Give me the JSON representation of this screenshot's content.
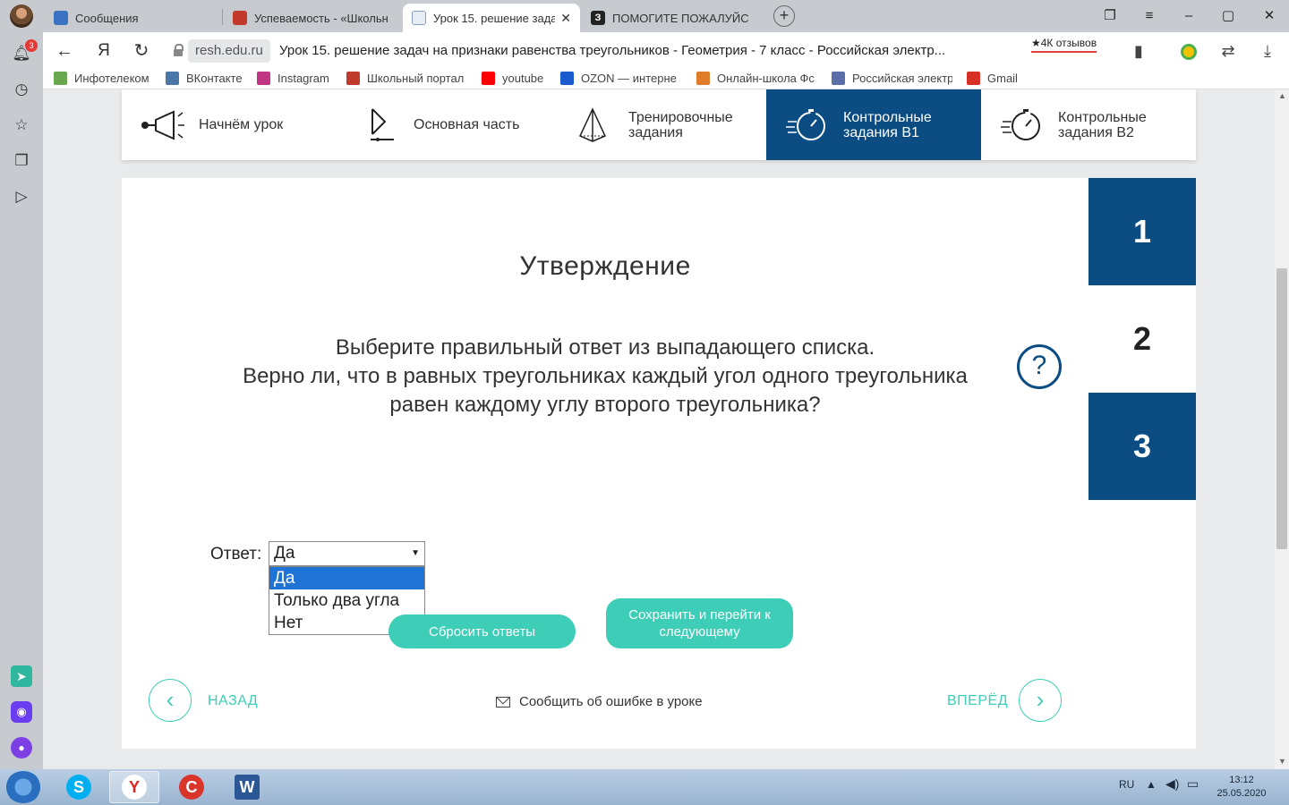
{
  "browser": {
    "tabs": [
      {
        "label": "Сообщения",
        "favicon_color": "#3b73c4"
      },
      {
        "label": "Успеваемость - «Школьн",
        "favicon_color": "#c0392b"
      },
      {
        "label": "Урок 15. решение зада",
        "favicon_color": "#4b6ea9",
        "active": true
      },
      {
        "label": "ПОМОГИТЕ ПОЖАЛУЙСТ",
        "favicon_color": "#222222"
      }
    ],
    "close_glyph": "✕",
    "new_tab_glyph": "+",
    "domain": "resh.edu.ru",
    "page_title": "Урок 15. решение задач на признаки равенства треугольников - Геометрия - 7 класс - Российская электр...",
    "reviews": "★4К отзывов",
    "bookmarks": [
      {
        "label": "Инфотелеком",
        "color": "#6aa84f"
      },
      {
        "label": "ВКонтакте",
        "color": "#4a76a8"
      },
      {
        "label": "Instagram",
        "color": "#c13584"
      },
      {
        "label": "Школьный портал",
        "color": "#c0392b"
      },
      {
        "label": "youtube",
        "color": "#ff0000"
      },
      {
        "label": "OZON — интерне",
        "color": "#1a5ccf"
      },
      {
        "label": "Онлайн-школа Фс",
        "color": "#e07b2a"
      },
      {
        "label": "Российская электр",
        "color": "#5b6ea8"
      },
      {
        "label": "Gmail",
        "color": "#d93025"
      }
    ],
    "notifications_badge": "3"
  },
  "lesson_nav": [
    {
      "label": "Начнём урок",
      "icon": "megaphone-icon"
    },
    {
      "label": "Основная часть",
      "icon": "play-icon"
    },
    {
      "label": "Тренировочные задания",
      "icon": "pyramid-icon"
    },
    {
      "label": "Контрольные задания В1",
      "icon": "timer-icon",
      "active": true
    },
    {
      "label": "Контрольные задания В2",
      "icon": "timer-icon"
    }
  ],
  "task": {
    "title": "Утверждение",
    "question_line1": "Выберите правильный ответ из выпадающего списка.",
    "question_line2": "Верно ли, что в равных треугольниках каждый угол одного треугольника",
    "question_line3": "равен каждому углу второго треугольника?",
    "help": "?",
    "answer_label": "Ответ:",
    "selected_value": "Да",
    "options": [
      "Да",
      "Только два угла",
      "Нет"
    ],
    "reset_label": "Сбросить ответы",
    "save_label": "Сохранить и перейти к следующему",
    "back_label": "НАЗАД",
    "forward_label": "ВПЕРЁД",
    "report_label": "Сообщить об ошибке в уроке"
  },
  "task_numbers": [
    "1",
    "2",
    "3"
  ],
  "current_task": "2",
  "taskbar": {
    "language": "RU",
    "time": "13:12",
    "date": "25.05.2020"
  },
  "colors": {
    "brand_blue": "#0b4d83",
    "accent_teal": "#3ecdb7",
    "dropdown_selected": "#1e73d4"
  }
}
